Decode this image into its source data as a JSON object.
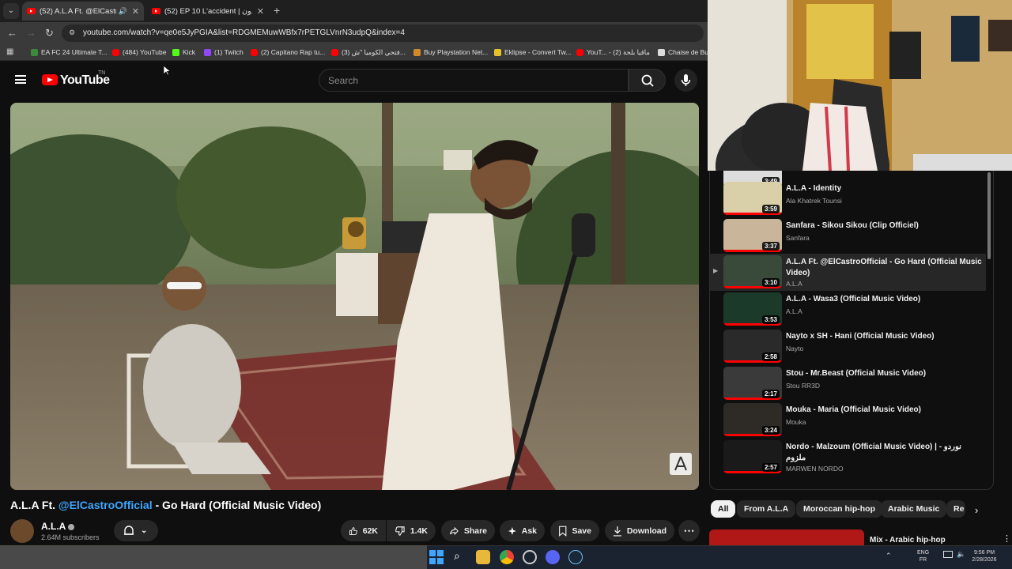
{
  "browser": {
    "tabs": [
      {
        "title": "(52) A.L.A Ft. @ElCastroOffi",
        "active": true
      },
      {
        "title": "(52) EP 10 L'accident | أكسيدون",
        "active": false
      }
    ],
    "url": "youtube.com/watch?v=qe0e5JyPGIA&list=RDGMEMuwWBfx7rPETGLVnrN3udpQ&index=4",
    "bookmarks": [
      "EA FC 24 Ultimate T...",
      "(484) YouTube",
      "Kick",
      "(1) Twitch",
      "(2) Capitano Rap tu...",
      "(3) فتحي الكوميا \"ش...",
      "Buy Playstation Net...",
      "Eklipse - Convert Tw...",
      "YouT... - (2) ماقيا بلحة",
      "Chaise de Bur"
    ]
  },
  "youtube": {
    "logo": "YouTube",
    "region": "TN",
    "search_placeholder": "Search"
  },
  "video": {
    "title_start": "A.L.A Ft. ",
    "title_mention": "@ElCastroOfficial",
    "title_end": " - Go Hard (Official Music Video)",
    "channel": "A.L.A",
    "subscribers": "2.64M subscribers",
    "likes": "62K",
    "dislikes": "1.4K",
    "share": "Share",
    "ask": "Ask",
    "save": "Save",
    "download": "Download"
  },
  "playlist": [
    {
      "title": "A.L.A - Identity",
      "channel": "Ala Khatrek Tounsi",
      "duration": "3:59",
      "current": false
    },
    {
      "title": "Sanfara - Sikou Sikou (Clip Officiel)",
      "channel": "Sanfara",
      "duration": "3:37",
      "current": false
    },
    {
      "title": "A.L.A Ft. @ElCastroOfficial - Go Hard (Official Music Video)",
      "channel": "A.L.A",
      "duration": "3:10",
      "current": true
    },
    {
      "title": "A.L.A - Wasa3 (Official Music Video)",
      "channel": "A.L.A",
      "duration": "3:53",
      "current": false
    },
    {
      "title": "Nayto x SH - Hani (Official Music Video)",
      "channel": "Nayto",
      "duration": "2:58",
      "current": false
    },
    {
      "title": "Stou - Mr.Beast (Official Music Video)",
      "channel": "Stou RR3D",
      "duration": "2:17",
      "current": false
    },
    {
      "title": "Mouka - Maria (Official Music Video)",
      "channel": "Mouka",
      "duration": "3:24",
      "current": false
    },
    {
      "title": "Nordo - Malzoum (Official Music Video) | نوردو - ملزوم",
      "channel": "MARWEN NORDO",
      "duration": "2:57",
      "current": false
    }
  ],
  "partial_item_duration": "3:49",
  "chips": [
    "All",
    "From A.L.A",
    "Moroccan hip-hop",
    "Arabic Music",
    "Re"
  ],
  "mix_title": "Mix - Arabic hip-hop",
  "taskbar": {
    "lang": "ENG",
    "layout": "FR",
    "time": "9:56 PM",
    "date": "2/28/2026"
  },
  "colors": {
    "accent": "#3ea6ff",
    "brand": "#ff0000",
    "background": "#0f0f0f"
  }
}
